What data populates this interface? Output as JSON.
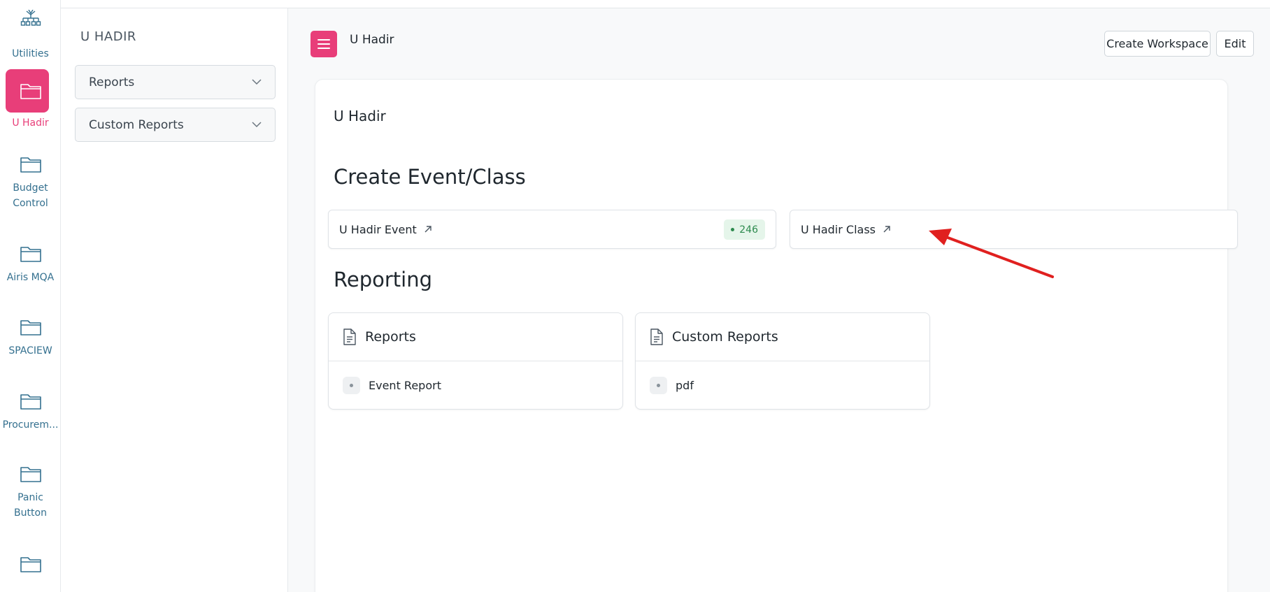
{
  "rail": {
    "items": [
      {
        "label": "Utilities",
        "icon": "sitemap-icon"
      },
      {
        "label": "U Hadir",
        "icon": "folder-icon",
        "active": true
      },
      {
        "label": "Budget Control",
        "icon": "folder-icon"
      },
      {
        "label": "Airis MQA",
        "icon": "folder-icon"
      },
      {
        "label": "SPACIEW",
        "icon": "folder-icon"
      },
      {
        "label": "Procurem...",
        "icon": "folder-icon"
      },
      {
        "label": "Panic Button",
        "icon": "folder-icon"
      },
      {
        "label": "",
        "icon": "folder-icon"
      }
    ],
    "color": "#34708f",
    "active_color": "#e83e79"
  },
  "sidebar": {
    "title": "U HADIR",
    "dropdowns": [
      {
        "label": "Reports"
      },
      {
        "label": "Custom Reports"
      }
    ]
  },
  "header": {
    "breadcrumb": "U Hadir",
    "create_workspace": "Create Workspace",
    "edit": "Edit"
  },
  "panel": {
    "title": "U Hadir",
    "shortcuts_heading": "Create Event/Class",
    "shortcuts": [
      {
        "label": "U Hadir Event",
        "count": "246"
      },
      {
        "label": "U Hadir Class"
      }
    ],
    "reporting_heading": "Reporting",
    "cards": [
      {
        "title": "Reports",
        "links": [
          "Event Report"
        ]
      },
      {
        "title": "Custom Reports",
        "links": [
          "pdf"
        ]
      }
    ]
  },
  "colors": {
    "accent": "#e83e79",
    "badge_green": "#2d8a4e",
    "annotation_arrow": "#e0201f"
  }
}
